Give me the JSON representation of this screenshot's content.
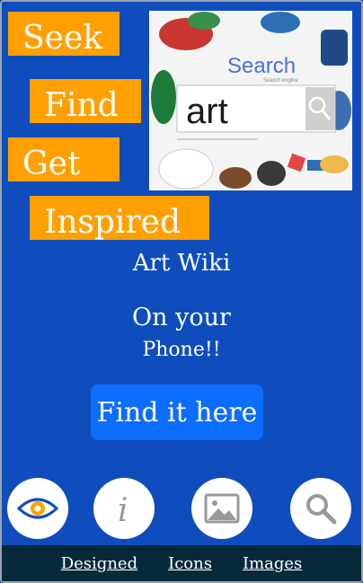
{
  "hero_words": [
    "Seek",
    "Find",
    "Get",
    "Inspired"
  ],
  "hero_image": {
    "search_logo_text": "Search",
    "search_subtext": "Search engine",
    "search_query": "art"
  },
  "intro": {
    "title": "Art Wiki",
    "line1": "On your",
    "line2": "Phone!!"
  },
  "cta": {
    "label": "Find it here"
  },
  "icons": [
    "eye-icon",
    "info-icon",
    "image-icon",
    "search-icon"
  ],
  "footer": {
    "links": [
      "Designed",
      "Icons",
      "Images"
    ]
  },
  "colors": {
    "background": "#0f4dbd",
    "accent_orange": "#ffa000",
    "cta_blue": "#0d6efd",
    "footer_bg": "#062a3a"
  }
}
